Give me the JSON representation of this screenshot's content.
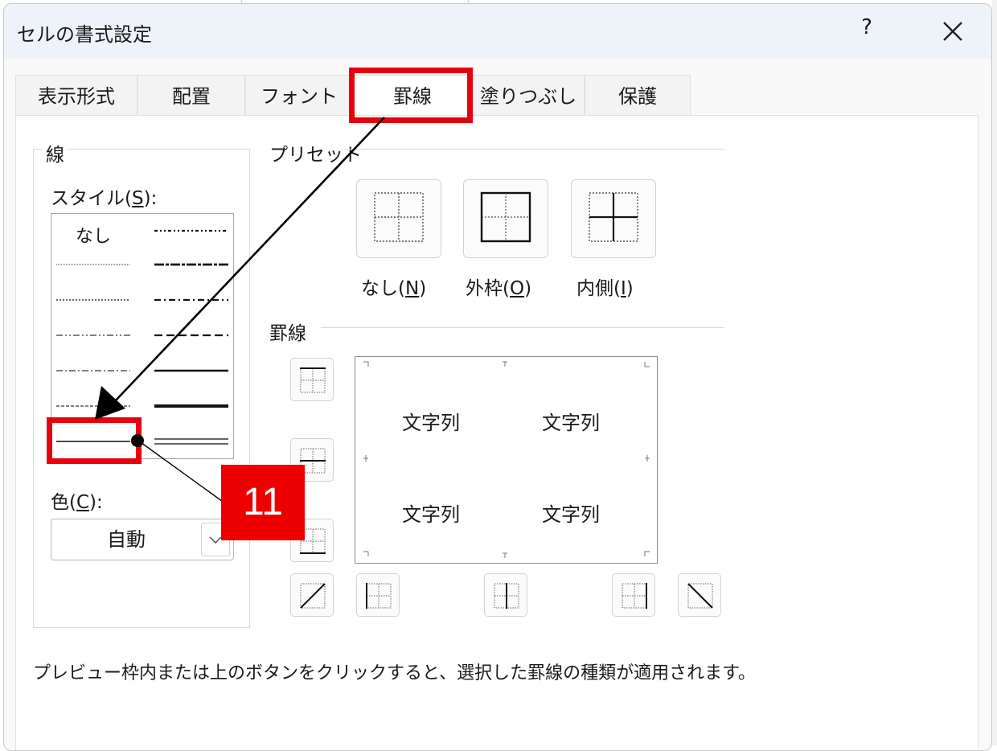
{
  "dialog": {
    "title": "セルの書式設定",
    "help_label": "?",
    "close_icon": "close-icon"
  },
  "tabs": [
    {
      "label": "表示形式",
      "active": false
    },
    {
      "label": "配置",
      "active": false
    },
    {
      "label": "フォント",
      "active": false
    },
    {
      "label": "罫線",
      "active": true
    },
    {
      "label": "塗りつぶし",
      "active": false
    },
    {
      "label": "保護",
      "active": false
    }
  ],
  "line_group": {
    "title": "線",
    "style_label_prefix": "スタイル(",
    "style_label_key": "S",
    "style_label_suffix": "):",
    "none_label": "なし",
    "selected_style": "thin-solid",
    "color_label_prefix": "色(",
    "color_label_key": "C",
    "color_label_suffix": "):",
    "color_value": "自動"
  },
  "presets": {
    "title": "プリセット",
    "buttons": [
      {
        "prefix": "なし(",
        "key": "N",
        "suffix": ")",
        "icon": "preset-none-icon"
      },
      {
        "prefix": "外枠(",
        "key": "O",
        "suffix": ")",
        "icon": "preset-outline-icon"
      },
      {
        "prefix": "内側(",
        "key": "I",
        "suffix": ")",
        "icon": "preset-inside-icon"
      }
    ]
  },
  "borders": {
    "title": "罫線",
    "preview_text": "文字列"
  },
  "footnote": "プレビュー枠内または上のボタンをクリックすると、選択した罫線の種類が適用されます。",
  "annotation": {
    "step_number": "11",
    "highlight_color": "#e8000f",
    "badge_color": "#ee0000"
  }
}
